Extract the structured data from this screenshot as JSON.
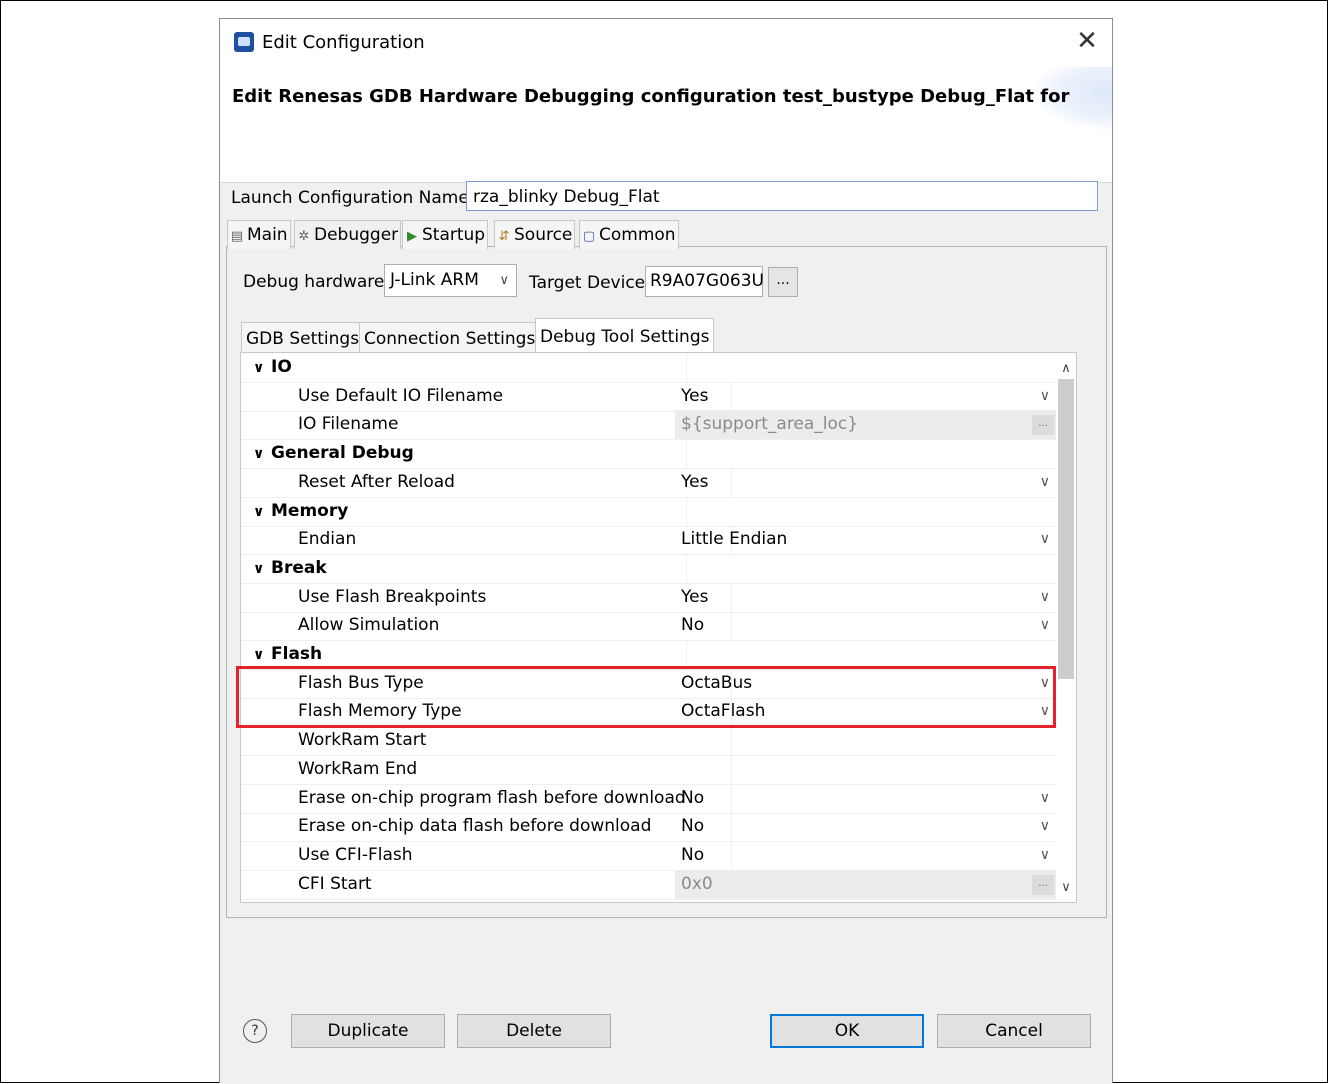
{
  "dialog": {
    "title": "Edit Configuration",
    "heading": "Edit Renesas GDB Hardware Debugging configuration test_bustype Debug_Flat for"
  },
  "launch_config": {
    "label": "Launch Configuration Name:",
    "value": "rza_blinky Debug_Flat"
  },
  "tabs": [
    {
      "label": "Main",
      "icon": "document-icon"
    },
    {
      "label": "Debugger",
      "icon": "bug-icon"
    },
    {
      "label": "Startup",
      "icon": "play-icon"
    },
    {
      "label": "Source",
      "icon": "source-icon"
    },
    {
      "label": "Common",
      "icon": "window-icon"
    }
  ],
  "debugger": {
    "debug_hardware_label": "Debug hardware:",
    "debug_hardware_value": "J-Link ARM",
    "target_device_label": "Target Device:",
    "target_device_value": "R9A07G063U",
    "browse_label": "..."
  },
  "subtabs": [
    "GDB Settings",
    "Connection Settings",
    "Debug Tool Settings"
  ],
  "rows": [
    {
      "type": "cat",
      "label": "IO",
      "value": ""
    },
    {
      "type": "item",
      "label": "Use Default IO Filename",
      "value": "Yes",
      "control": "dropdown"
    },
    {
      "type": "item",
      "label": "IO Filename",
      "value": "${support_area_loc}",
      "control": "browse",
      "disabled": true
    },
    {
      "type": "cat",
      "label": "General Debug",
      "value": ""
    },
    {
      "type": "item",
      "label": "Reset After Reload",
      "value": "Yes",
      "control": "dropdown"
    },
    {
      "type": "cat",
      "label": "Memory",
      "value": ""
    },
    {
      "type": "item",
      "label": "Endian",
      "value": "Little Endian",
      "control": "dropdown"
    },
    {
      "type": "cat",
      "label": "Break",
      "value": ""
    },
    {
      "type": "item",
      "label": "Use Flash Breakpoints",
      "value": "Yes",
      "control": "dropdown"
    },
    {
      "type": "item",
      "label": "Allow Simulation",
      "value": "No",
      "control": "dropdown"
    },
    {
      "type": "cat",
      "label": "Flash",
      "value": ""
    },
    {
      "type": "item",
      "label": "Flash Bus Type",
      "value": "OctaBus",
      "control": "dropdown"
    },
    {
      "type": "item",
      "label": "Flash Memory Type",
      "value": "OctaFlash",
      "control": "dropdown"
    },
    {
      "type": "item",
      "label": "WorkRam Start",
      "value": "",
      "control": "none"
    },
    {
      "type": "item",
      "label": "WorkRam End",
      "value": "",
      "control": "none"
    },
    {
      "type": "item",
      "label": "Erase on-chip program flash before download",
      "value": "No",
      "control": "dropdown"
    },
    {
      "type": "item",
      "label": "Erase on-chip data flash before download",
      "value": "No",
      "control": "dropdown"
    },
    {
      "type": "item",
      "label": "Use CFI-Flash",
      "value": "No",
      "control": "dropdown"
    },
    {
      "type": "item",
      "label": "CFI Start",
      "value": "0x0",
      "control": "browse",
      "disabled": true
    }
  ],
  "buttons": {
    "duplicate": "Duplicate",
    "delete": "Delete",
    "ok": "OK",
    "cancel": "Cancel",
    "help": "?"
  },
  "colors": {
    "highlight": "#e3222d",
    "default_button_border": "#0078d7"
  }
}
